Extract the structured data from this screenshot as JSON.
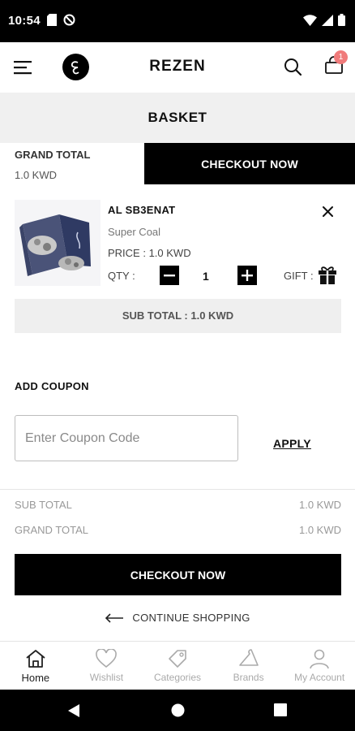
{
  "status_bar": {
    "time": "10:54"
  },
  "header": {
    "title": "REZEN",
    "cart_count": "1"
  },
  "basket": {
    "title": "BASKET"
  },
  "summary_top": {
    "grand_total_label": "GRAND TOTAL",
    "grand_total_value": "1.0 KWD",
    "checkout_label": "CHECKOUT NOW"
  },
  "product": {
    "name": "AL SB3ENAT",
    "variant": "Super Coal",
    "price": "PRICE :  1.0 KWD",
    "qty_label": "QTY :",
    "qty_value": "1",
    "gift_label": "GIFT :",
    "subtotal": "SUB TOTAL : 1.0 KWD"
  },
  "coupon": {
    "heading": "ADD COUPON",
    "placeholder": "Enter Coupon Code",
    "apply_label": "APPLY"
  },
  "totals": {
    "sub_total_label": "SUB TOTAL",
    "sub_total_value": "1.0 KWD",
    "grand_total_label": "GRAND TOTAL",
    "grand_total_value": "1.0 KWD"
  },
  "checkout_bottom_label": "CHECKOUT NOW",
  "continue_label": "CONTINUE SHOPPING",
  "bottom_nav": [
    {
      "label": "Home",
      "icon": "home-icon",
      "active": true
    },
    {
      "label": "Wishlist",
      "icon": "heart-icon",
      "active": false
    },
    {
      "label": "Categories",
      "icon": "tag-icon",
      "active": false
    },
    {
      "label": "Brands",
      "icon": "hanger-icon",
      "active": false
    },
    {
      "label": "My Account",
      "icon": "user-icon",
      "active": false
    }
  ],
  "colors": {
    "primary": "#000000",
    "badge": "#f07b7b",
    "muted_bg": "#f0f0f0",
    "muted_text": "#999999"
  }
}
